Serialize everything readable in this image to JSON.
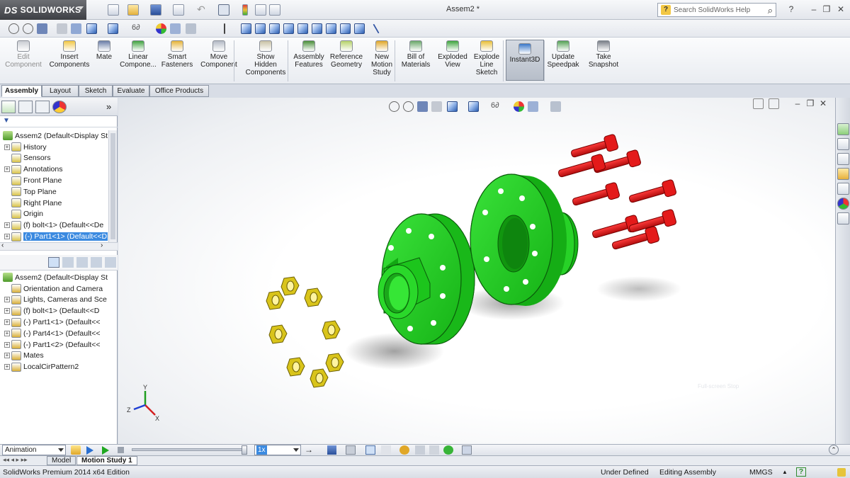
{
  "app": {
    "brand": "SOLIDWORKS",
    "brand_prefix": "DS",
    "window_title": "Assem2 *"
  },
  "search": {
    "placeholder": "Search SolidWorks Help"
  },
  "commands": [
    {
      "label": "Edit Component",
      "lines": [
        "Edit",
        "Component"
      ],
      "disabled": true
    },
    {
      "label": "Insert Components",
      "lines": [
        "Insert",
        "Components"
      ]
    },
    {
      "label": "Mate",
      "lines": [
        "Mate"
      ]
    },
    {
      "label": "Linear Compone...",
      "lines": [
        "Linear",
        "Compone..."
      ]
    },
    {
      "label": "Smart Fasteners",
      "lines": [
        "Smart",
        "Fasteners"
      ]
    },
    {
      "label": "Move Component",
      "lines": [
        "Move",
        "Component"
      ]
    },
    {
      "label": "Show Hidden Components",
      "lines": [
        "Show",
        "Hidden",
        "Components"
      ]
    },
    {
      "label": "Assembly Features",
      "lines": [
        "Assembly",
        "Features"
      ]
    },
    {
      "label": "Reference Geometry",
      "lines": [
        "Reference",
        "Geometry"
      ]
    },
    {
      "label": "New Motion Study",
      "lines": [
        "New",
        "Motion",
        "Study"
      ]
    },
    {
      "label": "Bill of Materials",
      "lines": [
        "Bill of",
        "Materials"
      ]
    },
    {
      "label": "Exploded View",
      "lines": [
        "Exploded",
        "View"
      ]
    },
    {
      "label": "Explode Line Sketch",
      "lines": [
        "Explode",
        "Line",
        "Sketch"
      ]
    },
    {
      "label": "Instant3D",
      "lines": [
        "Instant3D"
      ],
      "active": true
    },
    {
      "label": "Update Speedpak",
      "lines": [
        "Update",
        "Speedpak"
      ]
    },
    {
      "label": "Take Snapshot",
      "lines": [
        "Take",
        "Snapshot"
      ]
    }
  ],
  "tabs": [
    "Assembly",
    "Layout",
    "Sketch",
    "Evaluate",
    "Office Products"
  ],
  "feature_tree": {
    "root": "Assem2  (Default<Display St",
    "items": [
      {
        "label": "History",
        "expandable": true
      },
      {
        "label": "Sensors",
        "expandable": false
      },
      {
        "label": "Annotations",
        "expandable": true
      },
      {
        "label": "Front Plane",
        "expandable": false
      },
      {
        "label": "Top Plane",
        "expandable": false
      },
      {
        "label": "Right Plane",
        "expandable": false
      },
      {
        "label": "Origin",
        "expandable": false
      },
      {
        "label": "(f) bolt<1>  (Default<<De",
        "expandable": true
      },
      {
        "label": "(-) Part1<1>  (Default<<D",
        "expandable": true,
        "selected": true
      }
    ]
  },
  "motion_tree": {
    "root": "Assem2  (Default<Display St",
    "items": [
      {
        "label": "Orientation and Camera",
        "expandable": false
      },
      {
        "label": "Lights, Cameras and Sce",
        "expandable": true
      },
      {
        "label": "(f) bolt<1>  (Default<<D",
        "expandable": true
      },
      {
        "label": "(-) Part1<1>  (Default<<",
        "expandable": true
      },
      {
        "label": "(-) Part4<1>  (Default<<",
        "expandable": true
      },
      {
        "label": "(-) Part1<2>  (Default<<",
        "expandable": true
      },
      {
        "label": "Mates",
        "expandable": true
      },
      {
        "label": "LocalCirPattern2",
        "expandable": true
      }
    ]
  },
  "viewport": {
    "triad_labels": {
      "x": "X",
      "y": "Y",
      "z": "Z"
    },
    "overlay_hint": "Full-screen Stop",
    "colors": {
      "flange": "#1ed21e",
      "bolt": "#e01414",
      "nut": "#e6d21e"
    }
  },
  "motion": {
    "mode": "Animation",
    "speed": "1x"
  },
  "study_tabs": [
    "Model",
    "Motion Study 1"
  ],
  "status": {
    "edition": "SolidWorks Premium 2014 x64 Edition",
    "state": "Under Defined",
    "editing": "Editing Assembly",
    "units": "MMGS",
    "help": "?"
  }
}
